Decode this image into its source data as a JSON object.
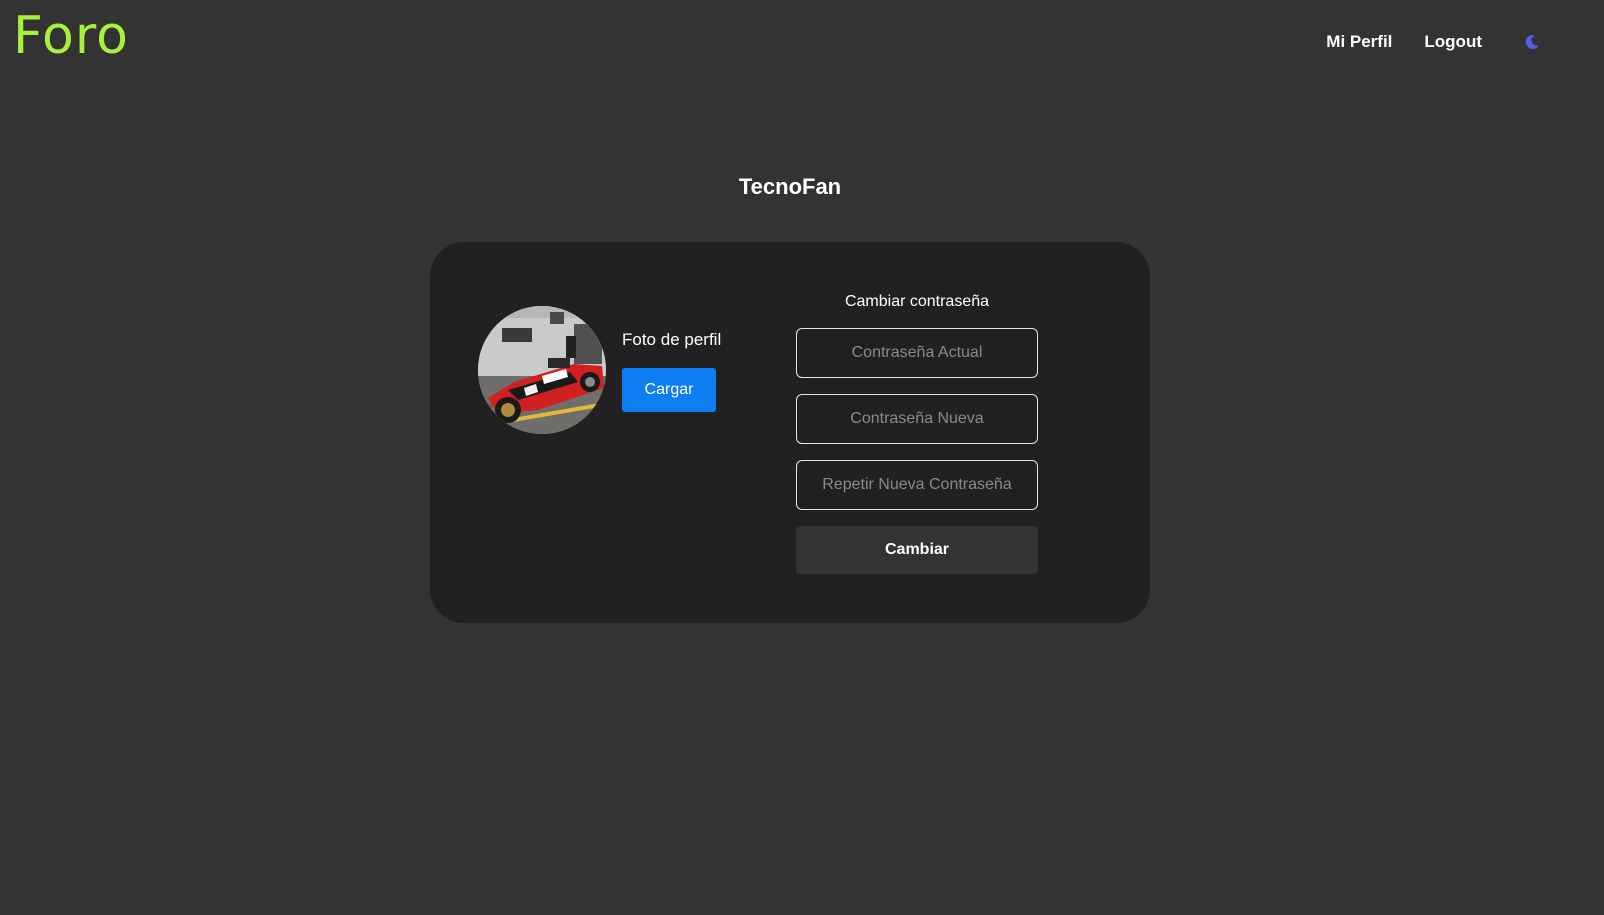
{
  "brand": {
    "logo_text": "Foro",
    "color": "#a8f03c"
  },
  "nav": {
    "links": [
      {
        "label": "Mi Perfil"
      },
      {
        "label": "Logout"
      }
    ],
    "theme_toggle_icon": "moon-icon",
    "theme_toggle_color": "#5b5bf0"
  },
  "profile": {
    "username": "TecnoFan",
    "avatar_description": "red-racing-car-photo",
    "photo_label": "Foto de perfil",
    "upload_button": "Cargar"
  },
  "password_form": {
    "title": "Cambiar contraseña",
    "current_placeholder": "Contraseña Actual",
    "new_placeholder": "Contraseña Nueva",
    "repeat_placeholder": "Repetir Nueva Contraseña",
    "submit_label": "Cambiar"
  },
  "colors": {
    "background": "#333333",
    "card": "#212121",
    "primary_button": "#0d7ff2"
  }
}
